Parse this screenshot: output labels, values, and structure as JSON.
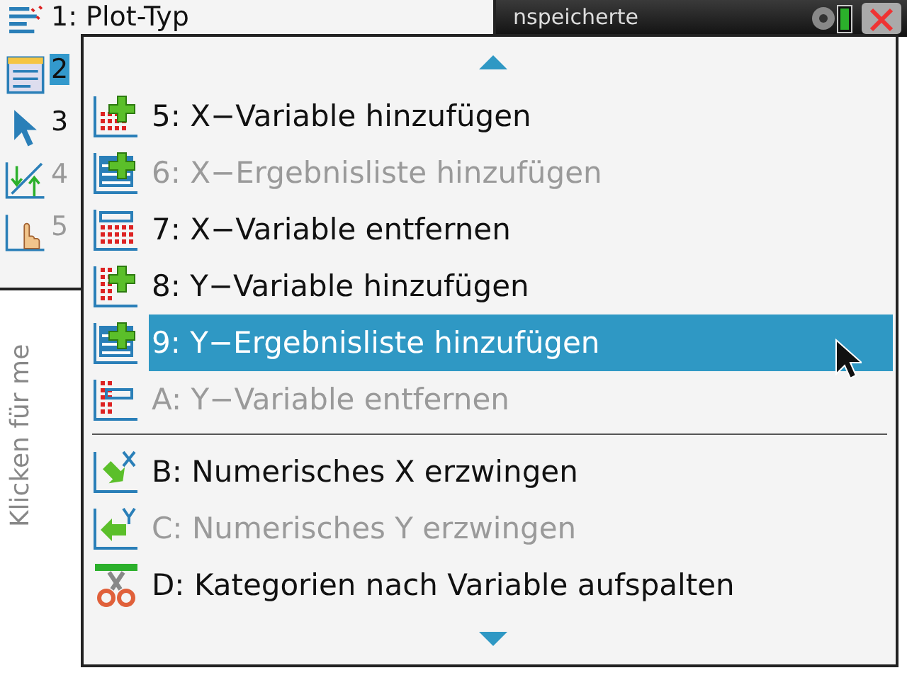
{
  "top_bar": {
    "title": "nspeicherte"
  },
  "menu": {
    "items": [
      {
        "label": "1: Plot-Typ",
        "selected": false,
        "disabled": false
      },
      {
        "label": "2",
        "selected": true,
        "disabled": false
      },
      {
        "label": "3",
        "selected": false,
        "disabled": false
      },
      {
        "label": "4",
        "selected": false,
        "disabled": true
      },
      {
        "label": "5",
        "selected": false,
        "disabled": true
      }
    ]
  },
  "side_hint": "Klicken für me",
  "submenu": {
    "items": [
      {
        "key": "5:",
        "label": "X−Variable hinzufügen",
        "disabled": false,
        "selected": false
      },
      {
        "key": "6:",
        "label": "X−Ergebnisliste hinzufügen",
        "disabled": true,
        "selected": false
      },
      {
        "key": "7:",
        "label": "X−Variable entfernen",
        "disabled": false,
        "selected": false
      },
      {
        "key": "8:",
        "label": "Y−Variable hinzufügen",
        "disabled": false,
        "selected": false
      },
      {
        "key": "9:",
        "label": "Y−Ergebnisliste hinzufügen",
        "disabled": false,
        "selected": true
      },
      {
        "key": "A:",
        "label": "Y−Variable entfernen",
        "disabled": true,
        "selected": false,
        "separator_after": true
      },
      {
        "key": "B:",
        "label": "Numerisches X erzwingen",
        "disabled": false,
        "selected": false
      },
      {
        "key": "C:",
        "label": "Numerisches Y erzwingen",
        "disabled": true,
        "selected": false
      },
      {
        "key": "D:",
        "label": "Kategorien nach Variable aufspalten",
        "disabled": false,
        "selected": false
      }
    ]
  }
}
